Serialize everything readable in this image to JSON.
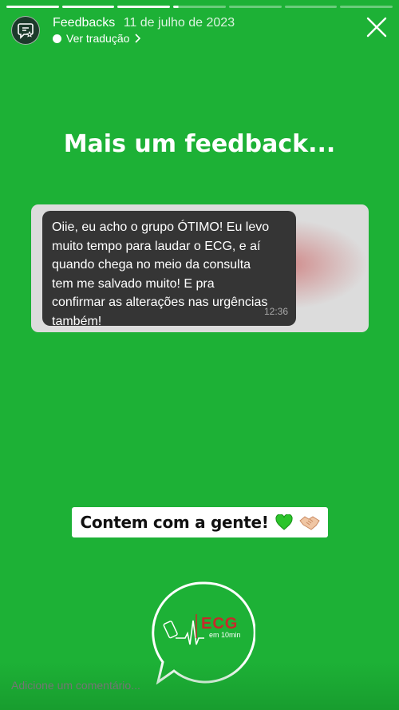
{
  "story": {
    "segments_total": 7,
    "segments_done": 3,
    "active_segment_progress": 0.1
  },
  "header": {
    "account_name": "Feedbacks",
    "date": "11 de julho de 2023",
    "translate_label": "Ver tradução",
    "avatar_icon": "review-icon",
    "close_icon": "close-icon"
  },
  "heading": "Mais um feedback...",
  "message": {
    "text": "Oiie, eu acho o grupo ÓTIMO! Eu levo\nmuito tempo para laudar o ECG, e aí\nquando chega no meio da consulta\ntem me salvado muito! E pra\nconfirmar as alterações nas urgências\ntambém!",
    "time": "12:36"
  },
  "sticker": {
    "text": "Contem com a gente!"
  },
  "logo": {
    "title": "ECG",
    "subtitle": "em 10min"
  },
  "comment": {
    "placeholder": "Adicione um comentário..."
  },
  "colors": {
    "background": "#1db136",
    "bubble": "#353535",
    "logo_red": "#c62a2a"
  }
}
